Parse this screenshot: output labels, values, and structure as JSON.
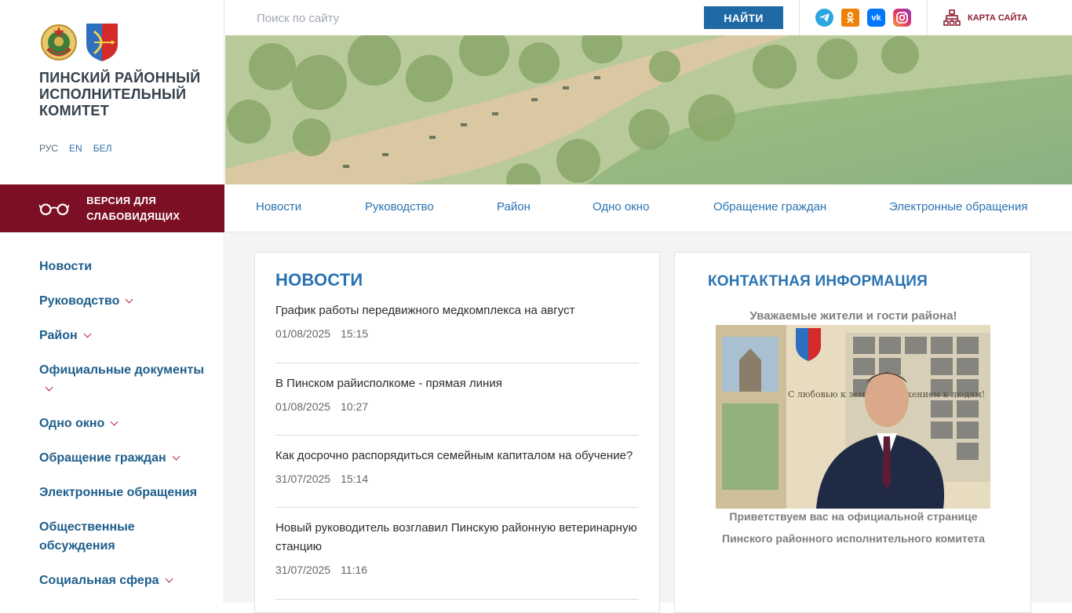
{
  "site": {
    "name": "ПИНСКИЙ РАЙОННЫЙ ИСПОЛНИТЕЛЬНЫЙ КОМИТЕТ",
    "languages": [
      "РУС",
      "EN",
      "БЕЛ"
    ],
    "low_vision_label": "ВЕРСИЯ ДЛЯ СЛАБОВИДЯЩИХ"
  },
  "search": {
    "placeholder": "Поиск по сайту",
    "button_label": "НАЙТИ"
  },
  "social": {
    "telegram": {
      "icon": "telegram-icon",
      "color": "#2ca5e0"
    },
    "odnoklassniki": {
      "icon": "odnoklassniki-icon",
      "color": "#ee8208"
    },
    "vk": {
      "icon": "vk-icon",
      "color": "#0077ff"
    },
    "instagram": {
      "icon": "instagram-icon",
      "color": "#c13584"
    }
  },
  "sitemap_label": "КАРТА САЙТА",
  "main_nav": [
    "Новости",
    "Руководство",
    "Район",
    "Одно окно",
    "Обращение граждан",
    "Электронные обращения"
  ],
  "sidebar": {
    "items": [
      {
        "label": "Новости",
        "has_submenu": false
      },
      {
        "label": "Руководство",
        "has_submenu": true
      },
      {
        "label": "Район",
        "has_submenu": true
      },
      {
        "label": "Официальные документы",
        "has_submenu": true
      },
      {
        "label": "Одно окно",
        "has_submenu": true
      },
      {
        "label": "Обращение граждан",
        "has_submenu": true
      },
      {
        "label": "Электронные обращения",
        "has_submenu": false
      },
      {
        "label": "Общественные обсуждения",
        "has_submenu": false
      },
      {
        "label": "Социальная сфера",
        "has_submenu": true
      }
    ]
  },
  "news": {
    "title": "НОВОСТИ",
    "items": [
      {
        "title": "График работы передвижного медкомплекса на август",
        "date": "01/08/2025",
        "time": "15:15"
      },
      {
        "title": "В Пинском райисполкоме - прямая линия",
        "date": "01/08/2025",
        "time": "10:27"
      },
      {
        "title": "Как досрочно распорядиться семейным капиталом на обучение?",
        "date": "31/07/2025",
        "time": "15:14"
      },
      {
        "title": "Новый руководитель возглавил Пинскую районную ветеринарную станцию",
        "date": "31/07/2025",
        "time": "11:16"
      }
    ]
  },
  "contact": {
    "title": "КОНТАКТНАЯ ИНФОРМАЦИЯ",
    "greeting": "Уважаемые жители и гости района!",
    "photo_caption_text": "С любовью к земле, с уважением к людям!",
    "welcome_line1": "Приветствуем вас на официальной странице",
    "welcome_line2": "Пинского районного исполнительного комитета"
  },
  "colors": {
    "accent_blue": "#1f69a5",
    "brand_red": "#7c0f24",
    "nav_blue": "#2a73b2"
  }
}
